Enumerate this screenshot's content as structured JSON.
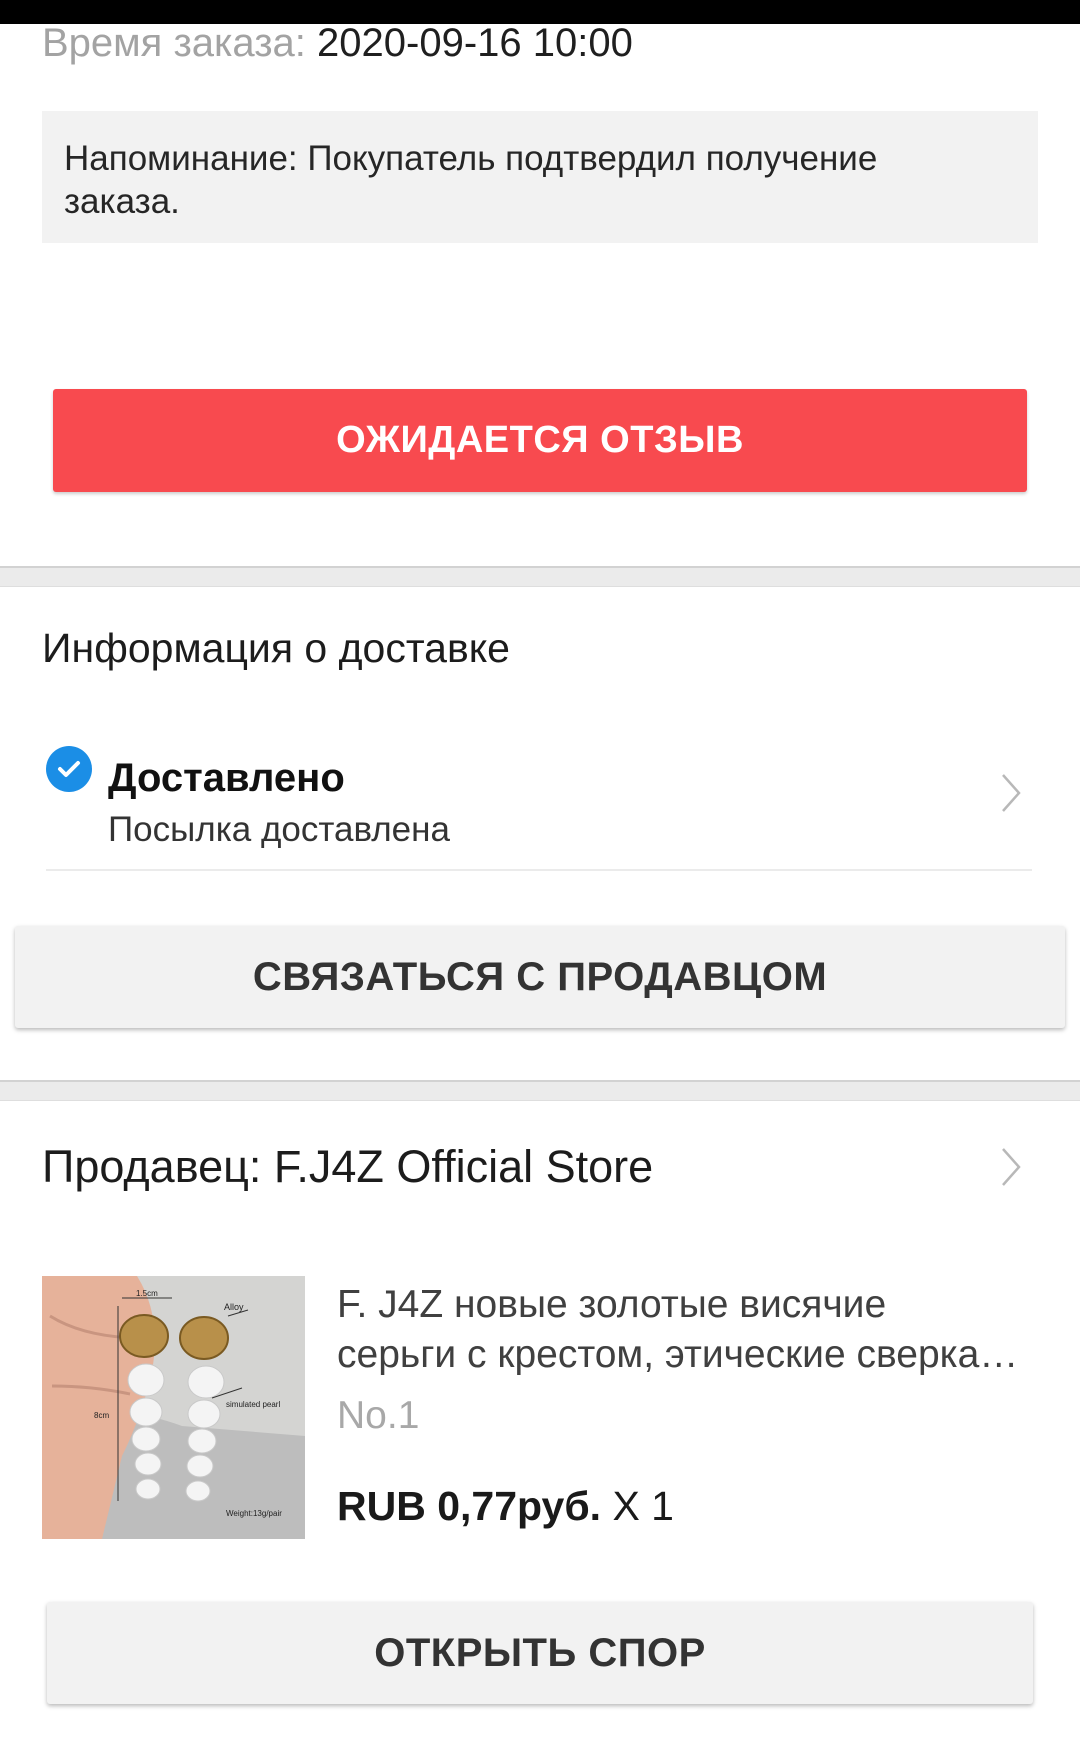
{
  "order": {
    "time_label": "Время заказа:",
    "time_value": "2020-09-16 10:00"
  },
  "reminder": {
    "line1": "Напоминание: Покупатель подтвердил получение",
    "line2": "заказа."
  },
  "actions": {
    "awaiting_review": "ОЖИДАЕТСЯ ОТЗЫВ",
    "contact_seller": "СВЯЗАТЬСЯ С ПРОДАВЦОМ",
    "open_dispute": "ОТКРЫТЬ СПОР"
  },
  "delivery": {
    "section_title": "Информация о доставке",
    "status": "Доставлено",
    "status_detail": "Посылка доставлена",
    "status_icon": "checkmark-circle-icon",
    "status_color": "#1b8ee6"
  },
  "seller": {
    "label": "Продавец: F.J4Z Official Store"
  },
  "product": {
    "title_line1": "F. J4Z новые золотые висячие",
    "title_line2": "серьги с крестом, этические сверкающие",
    "variant": "No.1",
    "price": "RUB 0,77руб.",
    "quantity": " X 1",
    "image_labels": {
      "width": "1.5cm",
      "material": "Alloy",
      "pearl": "simulated pearl",
      "length": "8cm",
      "weight": "Weight:13g/pair"
    }
  },
  "colors": {
    "primary_button": "#f84a4f",
    "secondary_button": "#f2f2f2",
    "reminder_bg": "#f2f2f2"
  }
}
